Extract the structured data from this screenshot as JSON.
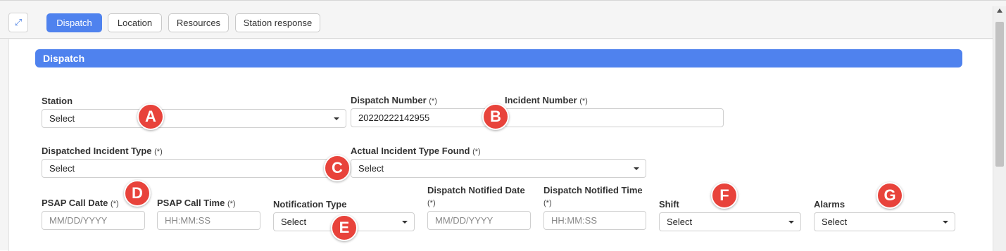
{
  "tabs": [
    {
      "label": "Dispatch",
      "active": true
    },
    {
      "label": "Location",
      "active": false
    },
    {
      "label": "Resources",
      "active": false
    },
    {
      "label": "Station response",
      "active": false
    }
  ],
  "section": {
    "title": "Dispatch"
  },
  "fields": {
    "station": {
      "label": "Station",
      "value": "Select"
    },
    "dispatch_number": {
      "label": "Dispatch Number",
      "required": "(*)",
      "value": "20220222142955"
    },
    "incident_number": {
      "label": "Incident Number",
      "required": "(*)",
      "value": ""
    },
    "dispatched_incident_type": {
      "label": "Dispatched Incident Type",
      "required": "(*)",
      "value": "Select"
    },
    "actual_incident_type": {
      "label": "Actual Incident Type Found",
      "required": "(*)",
      "value": "Select"
    },
    "psap_call_date": {
      "label": "PSAP Call Date",
      "required": "(*)",
      "placeholder": "MM/DD/YYYY"
    },
    "psap_call_time": {
      "label": "PSAP Call Time",
      "required": "(*)",
      "placeholder": "HH:MM:SS"
    },
    "notification_type": {
      "label": "Notification Type",
      "value": "Select"
    },
    "dispatch_notified_date": {
      "label": "Dispatch Notified Date",
      "required": "(*)",
      "placeholder": "MM/DD/YYYY"
    },
    "dispatch_notified_time": {
      "label": "Dispatch Notified Time",
      "required": "(*)",
      "placeholder": "HH:MM:SS"
    },
    "shift": {
      "label": "Shift",
      "value": "Select"
    },
    "alarms": {
      "label": "Alarms",
      "value": "Select"
    }
  },
  "markers": {
    "a": "A",
    "b": "B",
    "c": "C",
    "d": "D",
    "e": "E",
    "f": "F",
    "g": "G"
  },
  "colors": {
    "accent": "#4f82ee",
    "marker": "#e8433b"
  },
  "icons": {
    "expand": "expand-icon",
    "dropdown": "caret-down-icon"
  }
}
